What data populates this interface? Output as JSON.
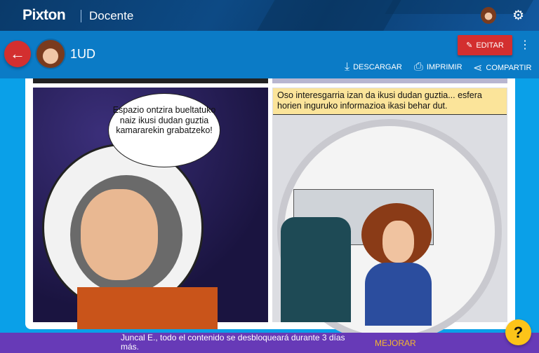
{
  "header": {
    "logo": "Pixton",
    "section": "Docente",
    "settings_icon": "gear-icon"
  },
  "toolbar": {
    "back_icon": "←",
    "title": "1UD",
    "edit_label": "EDITAR",
    "download_label": "DESCARGAR",
    "print_label": "IMPRIMIR",
    "share_label": "COMPARTIR"
  },
  "comic": {
    "panel1": {
      "speech": "Espazio ontzira bueltatuko naiz ikusi dudan guztia kamararekin grabatzeko!"
    },
    "panel2": {
      "caption": "Oso interesgarria izan da ikusi dudan guztia... esfera horien inguruko informazioa ikasi behar dut."
    }
  },
  "footer": {
    "message": "Juncal E., todo el contenido se desbloqueará durante 3 días más.",
    "upgrade_label": "MEJORAR",
    "help_label": "?"
  }
}
